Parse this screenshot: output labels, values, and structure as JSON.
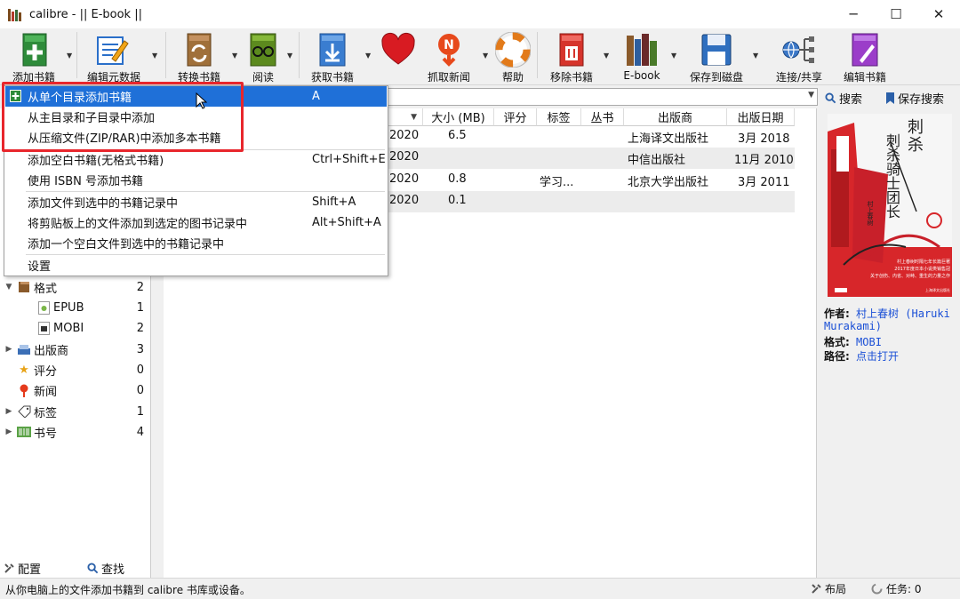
{
  "window": {
    "title": "calibre - || E-book ||",
    "minimize": "─",
    "maximize": "☐",
    "close": "✕"
  },
  "toolbar": {
    "add_books": "添加书籍",
    "edit_metadata": "编辑元数据",
    "convert_books": "转换书籍",
    "view": "阅读",
    "get_books": "获取书籍",
    "fetch_news": "抓取新闻",
    "help": "帮助",
    "remove_books": "移除书籍",
    "library": "E-book",
    "save_to_disk": "保存到磁盘",
    "connect_share": "连接/共享",
    "edit_book": "编辑书籍"
  },
  "search": {
    "search_label": "搜索",
    "saved_search_label": "保存搜索"
  },
  "add_menu": {
    "items": [
      {
        "label": "从单个目录添加书籍",
        "shortcut": "A"
      },
      {
        "label": "从主目录和子目录中添加",
        "shortcut": ""
      },
      {
        "label": "从压缩文件(ZIP/RAR)中添加多本书籍",
        "shortcut": ""
      },
      {
        "label": "添加空白书籍(无格式书籍)",
        "shortcut": "Ctrl+Shift+E"
      },
      {
        "label": "使用 ISBN 号添加书籍",
        "shortcut": ""
      },
      {
        "label": "添加文件到选中的书籍记录中",
        "shortcut": "Shift+A"
      },
      {
        "label": "将剪贴板上的文件添加到选定的图书记录中",
        "shortcut": "Alt+Shift+A"
      },
      {
        "label": "添加一个空白文件到选中的书籍记录中",
        "shortcut": ""
      },
      {
        "label": "设置",
        "shortcut": ""
      }
    ]
  },
  "tag_browser": {
    "items": [
      {
        "label": "格式",
        "count": "2"
      },
      {
        "label": "EPUB",
        "count": "1"
      },
      {
        "label": "MOBI",
        "count": "2"
      },
      {
        "label": "出版商",
        "count": "3"
      },
      {
        "label": "评分",
        "count": "0"
      },
      {
        "label": "新闻",
        "count": "0"
      },
      {
        "label": "标签",
        "count": "1"
      },
      {
        "label": "书号",
        "count": "4"
      }
    ],
    "configure": "配置",
    "find": "查找"
  },
  "book_list": {
    "columns": {
      "date_partial": "期",
      "size": "大小 (MB)",
      "rating": "评分",
      "tags": "标签",
      "series": "丛书",
      "publisher": "出版商",
      "pubdate": "出版日期"
    },
    "rows": [
      {
        "date": "2020",
        "size": "6.5",
        "tags": "",
        "publisher": "上海译文出版社",
        "pubdate": "3月 2018"
      },
      {
        "date": "2020",
        "size": "",
        "tags": "",
        "publisher": "中信出版社",
        "pubdate": "11月 2010"
      },
      {
        "date": "2020",
        "size": "0.8",
        "tags": "学习...",
        "publisher": "北京大学出版社",
        "pubdate": "3月 2011"
      },
      {
        "date": "2020",
        "size": "0.1",
        "tags": "",
        "publisher": "",
        "pubdate": ""
      }
    ]
  },
  "details": {
    "cover_title": "刺杀骑士团长",
    "cover_author_small": "村上春树",
    "cover_blurb_1": "村上春树时隔七年长篇巨著",
    "cover_blurb_2": "2017年度日本小说类销售冠",
    "cover_blurb_3": "关于创伤、内省、对峙、重生的力量之作",
    "cover_publisher": "上海译文出版社",
    "author_label": "作者:",
    "author_value_1": "村上春树 (Haruki",
    "author_value_2": "Murakami)",
    "formats_label": "格式:",
    "formats_value": "MOBI",
    "path_label": "路径:",
    "path_value": "点击打开"
  },
  "status": {
    "message": "从你电脑上的文件添加书籍到 calibre 书库或设备。",
    "layout": "布局",
    "jobs": "任务:  0"
  },
  "colors": {
    "menu_highlight": "#1f70d8",
    "callout_border": "#e8262c",
    "link": "#1a4fd6"
  }
}
